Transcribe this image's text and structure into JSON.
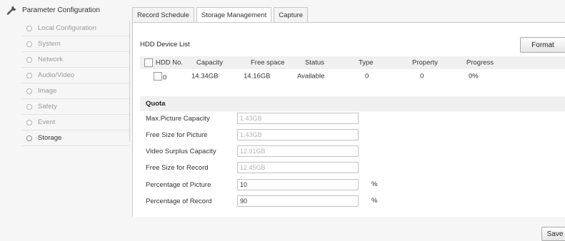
{
  "sidebar": {
    "title": "Parameter Configuration",
    "items": [
      {
        "label": "Local Configuration"
      },
      {
        "label": "System"
      },
      {
        "label": "Network"
      },
      {
        "label": "Audio/Video"
      },
      {
        "label": "Image"
      },
      {
        "label": "Safety"
      },
      {
        "label": "Event"
      },
      {
        "label": "Storage"
      }
    ],
    "active": "Storage"
  },
  "tabs": [
    {
      "label": "Record Schedule"
    },
    {
      "label": "Storage Management"
    },
    {
      "label": "Capture"
    }
  ],
  "active_tab": "Storage Management",
  "hdd": {
    "section_title": "HDD Device List",
    "format_label": "Format",
    "columns": [
      "HDD No.",
      "Capacity",
      "Free space",
      "Status",
      "Type",
      "Property",
      "Progress"
    ],
    "rows": [
      {
        "no": "0",
        "capacity": "14.34GB",
        "free": "14.16GB",
        "status": "Available",
        "type": "0",
        "property": "0",
        "progress": "0%"
      }
    ]
  },
  "quota": {
    "title": "Quota",
    "fields": [
      {
        "label": "Max.Picture Capacity",
        "value": "1.43GB"
      },
      {
        "label": "Free Size for Picture",
        "value": "1.43GB"
      },
      {
        "label": "Video Surplus Capacity",
        "value": "12.91GB"
      },
      {
        "label": "Free Size for Record",
        "value": "12.45GB"
      },
      {
        "label": "Percentage of Picture",
        "value": "10",
        "unit": "%"
      },
      {
        "label": "Percentage of Record",
        "value": "90",
        "unit": "%"
      }
    ]
  },
  "save_label": "Save"
}
